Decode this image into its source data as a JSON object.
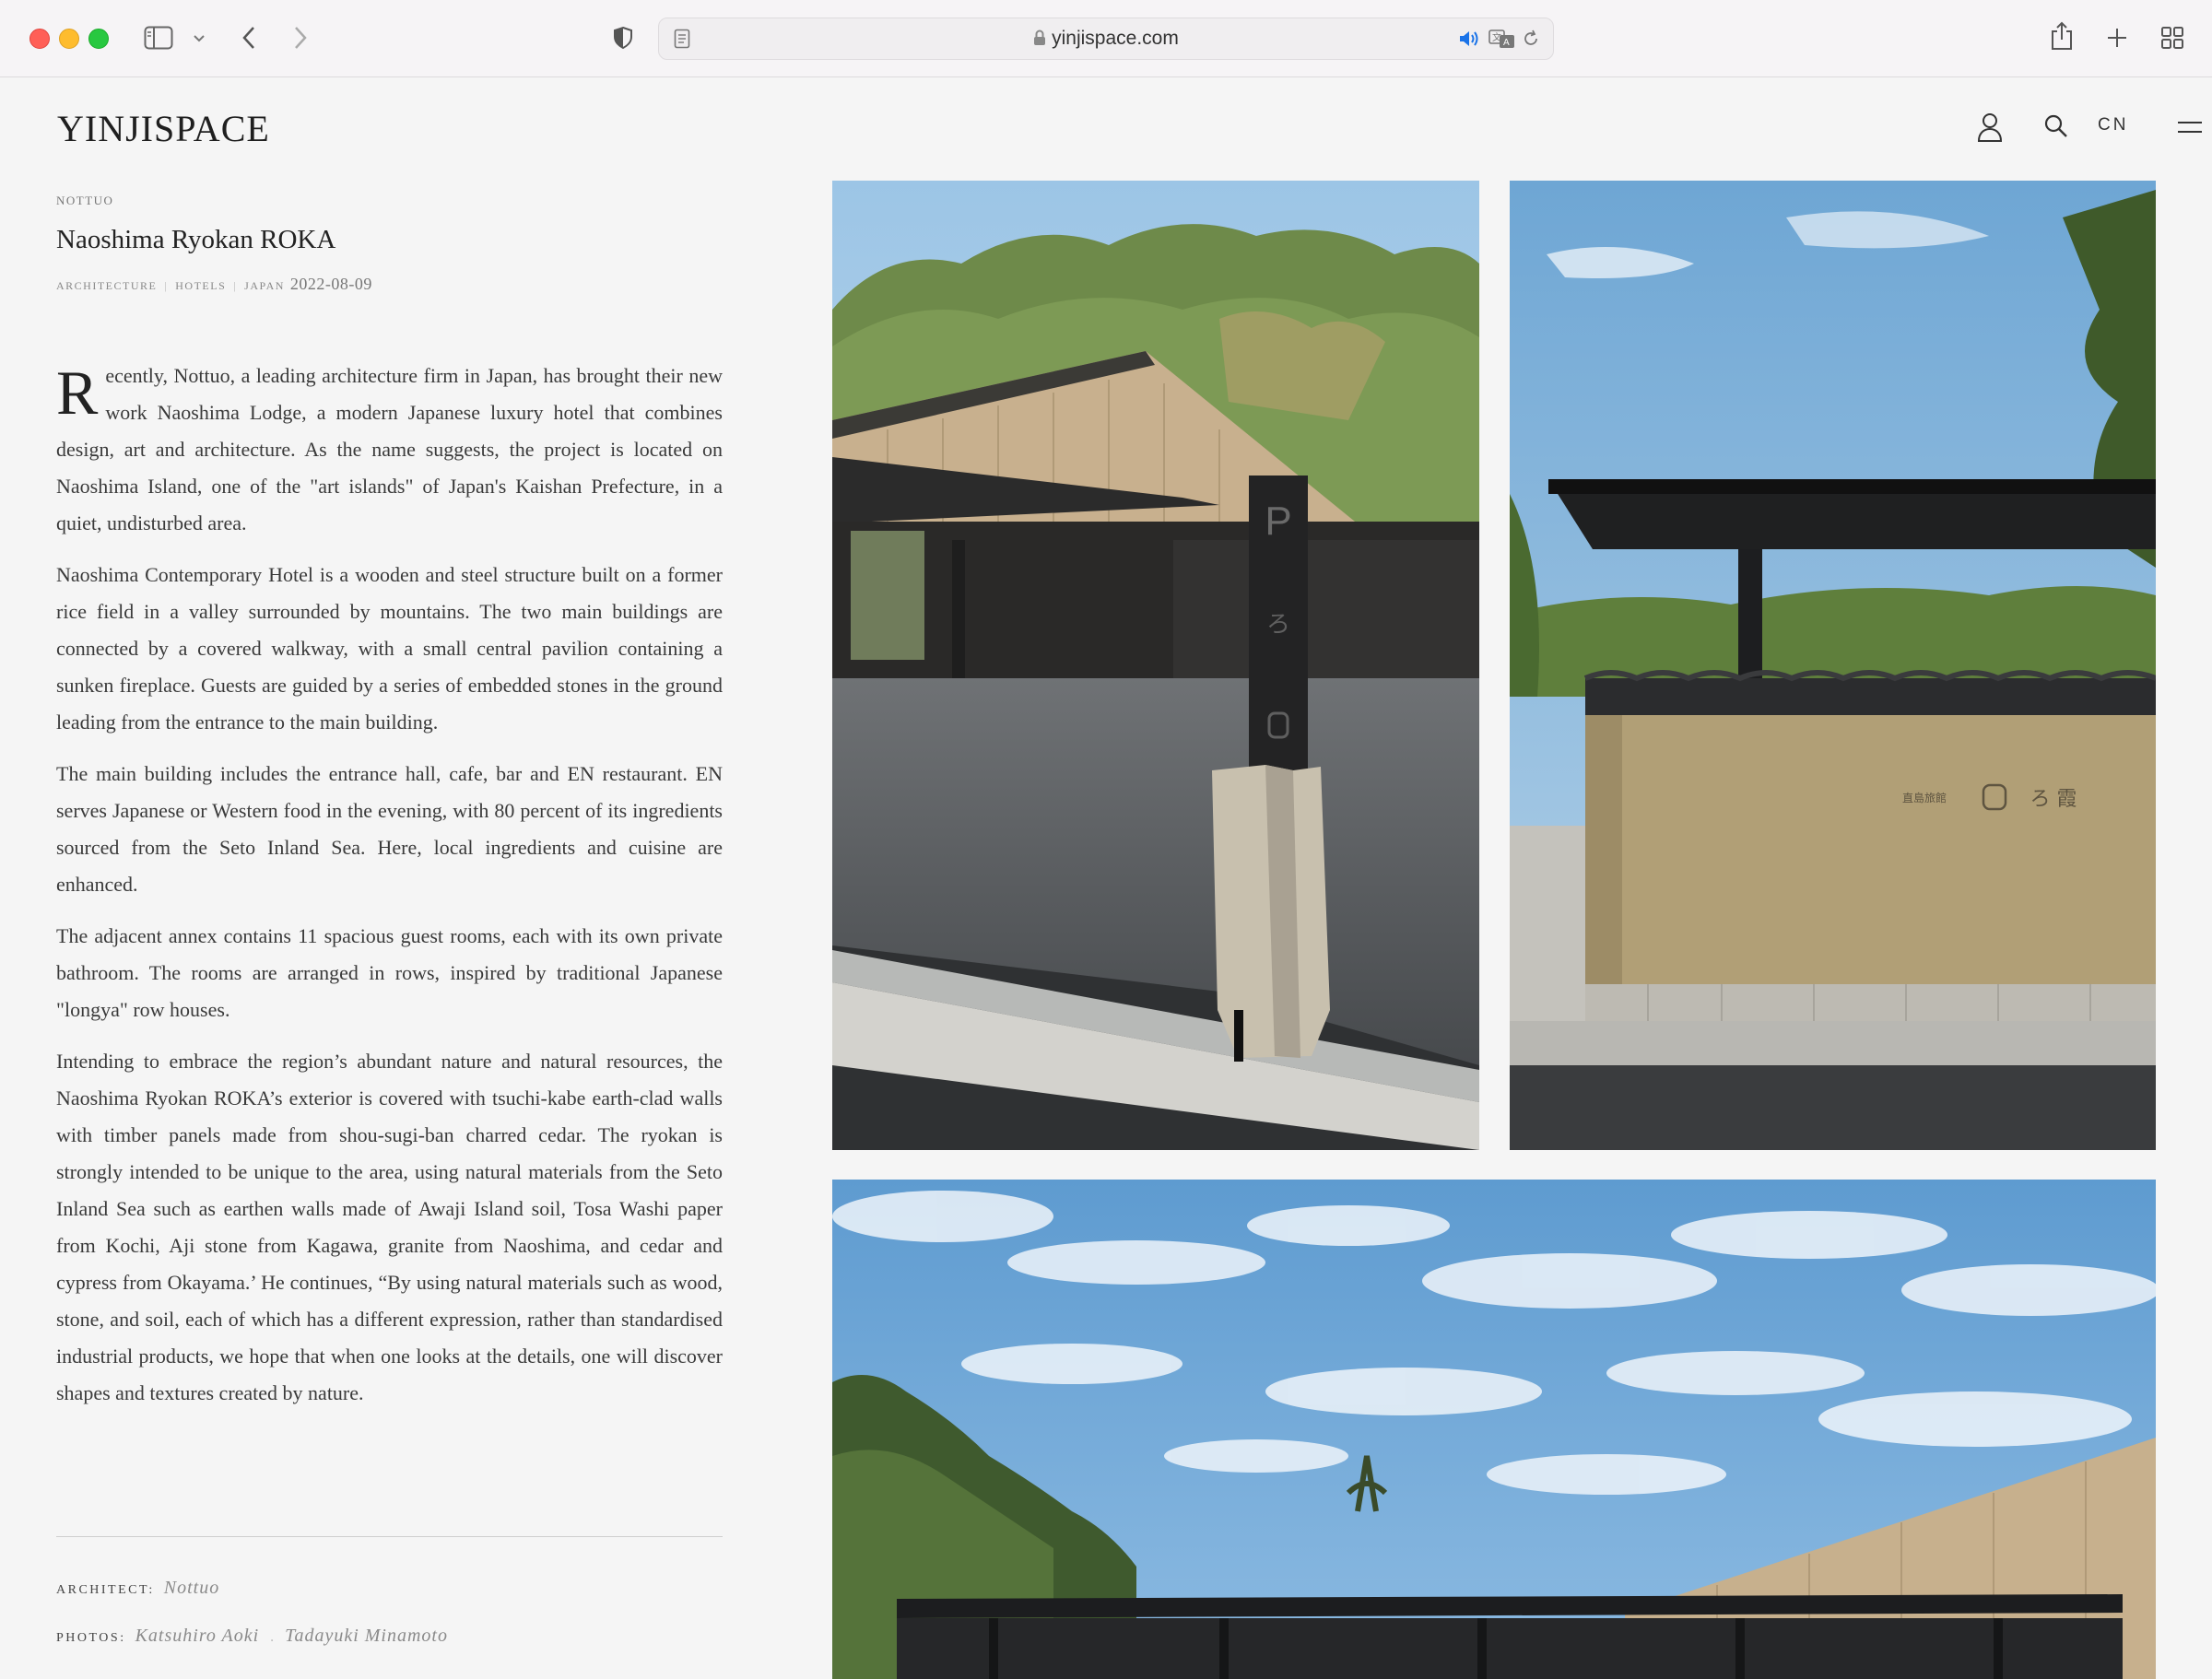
{
  "browser": {
    "url": "yinjispace.com"
  },
  "site": {
    "logo": "YINJISPACE",
    "lang": "CN"
  },
  "article": {
    "eyebrow": "NOTTUO",
    "title": "Naoshima Ryokan ROKA",
    "tags": [
      "ARCHITECTURE",
      "HOTELS",
      "JAPAN"
    ],
    "date": "2022-08-09",
    "dropcap": "R",
    "paragraphs": [
      "ecently, Nottuo, a leading architecture firm in Japan, has brought their new work Naoshima Lodge, a modern Japanese luxury hotel that combines design, art and architecture. As the name suggests, the project is located on Naoshima Island, one of the \"art islands\" of Japan's Kaishan Prefecture, in a quiet, undisturbed area.",
      "Naoshima Contemporary Hotel is a wooden and steel structure built on a former rice field in a valley surrounded by mountains. The two main buildings are connected by a covered walkway, with a small central pavilion containing a sunken fireplace. Guests are guided by a series of embedded stones in the ground leading from the entrance to the main building.",
      "The main building includes the entrance hall, cafe, bar and EN restaurant. EN serves Japanese or Western food in the evening, with 80 percent of its ingredients sourced from the Seto Inland Sea. Here, local ingredients and cuisine are enhanced.",
      "The adjacent annex contains 11 spacious guest rooms, each with its own private bathroom. The rooms are arranged in rows, inspired by traditional Japanese \"longya\" row houses.",
      "Intending to embrace the region’s abundant nature and natural resources, the Naoshima Ryokan ROKA’s exterior is covered with tsuchi-kabe earth-clad walls with timber panels made from shou-sugi-ban charred cedar. The ryokan is strongly intended to be unique to the area, using natural materials from the Seto Inland Sea such as earthen walls made of Awaji Island soil, Tosa Washi paper from Kochi, Aji stone from Kagawa, granite from Naoshima, and cedar and cypress from Okayama.’ He continues, “By using natural materials such as wood, stone, and soil, each of which has a different expression, rather than standardised industrial products, we hope that when one looks at the details, one will discover shapes and textures created by nature."
    ],
    "architect_label": "ARCHITECT:",
    "architect": "Nottuo",
    "photos_label": "PHOTOS:",
    "photographers": [
      "Katsuhiro Aoki",
      "Tadayuki Minamoto"
    ]
  },
  "photos": {
    "sign_text": "P",
    "sign_kana": "ろ",
    "wall_sign": "直島旅館",
    "wall_kana": "ろ 霞"
  },
  "colors": {
    "background": "#f5f5f5",
    "chrome": "#f6f4f6",
    "text": "#3a3a3a",
    "muted": "#8a8a8a"
  }
}
